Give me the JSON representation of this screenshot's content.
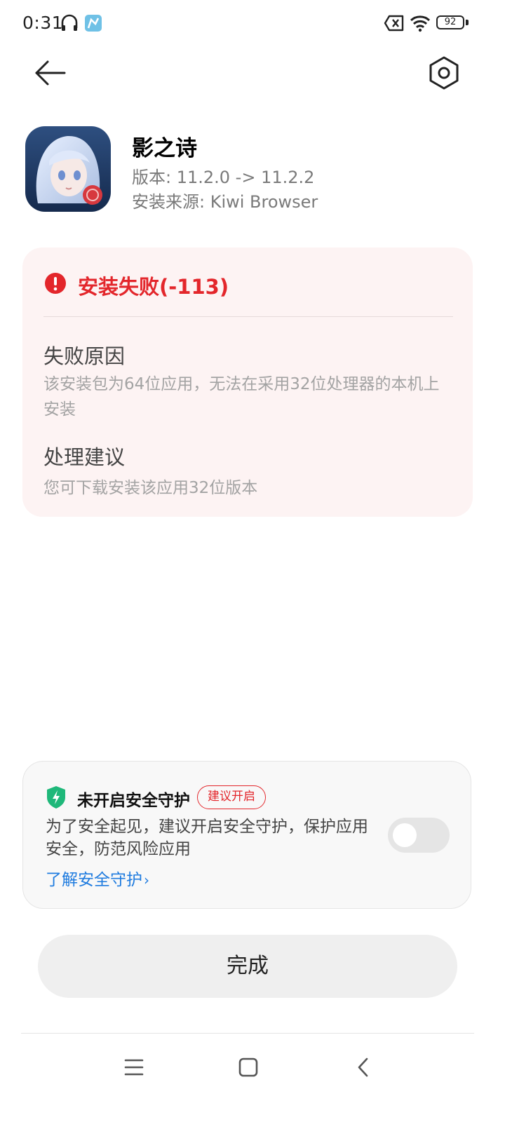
{
  "status_bar": {
    "time": "0:31",
    "battery": "92",
    "icons": [
      "headphones-icon",
      "app-notification-icon",
      "no-sim-icon",
      "wifi-icon",
      "battery-icon"
    ]
  },
  "header": {
    "back_icon": "back-arrow-icon",
    "settings_icon": "settings-hexagon-icon"
  },
  "app": {
    "name": "影之诗",
    "version": "版本: 11.2.0 -> 11.2.2",
    "source": "安装来源: Kiwi Browser"
  },
  "error": {
    "title": "安装失败(-113)",
    "reason_label": "失败原因",
    "reason_text": "该安装包为64位应用，无法在采用32位处理器的本机上安装",
    "advice_label": "处理建议",
    "advice_text": "您可下载安装该应用32位版本",
    "color": "#e3262b"
  },
  "security": {
    "title": "未开启安全守护",
    "badge": "建议开启",
    "description": "为了安全起见，建议开启安全守护，保护应用安全，防范风险应用",
    "link": "了解安全守护",
    "toggle_on": false,
    "shield_color": "#1fb87a",
    "link_color": "#1e7bdf"
  },
  "done_button": "完成",
  "nav": [
    "menu-icon",
    "home-icon",
    "back-icon"
  ]
}
